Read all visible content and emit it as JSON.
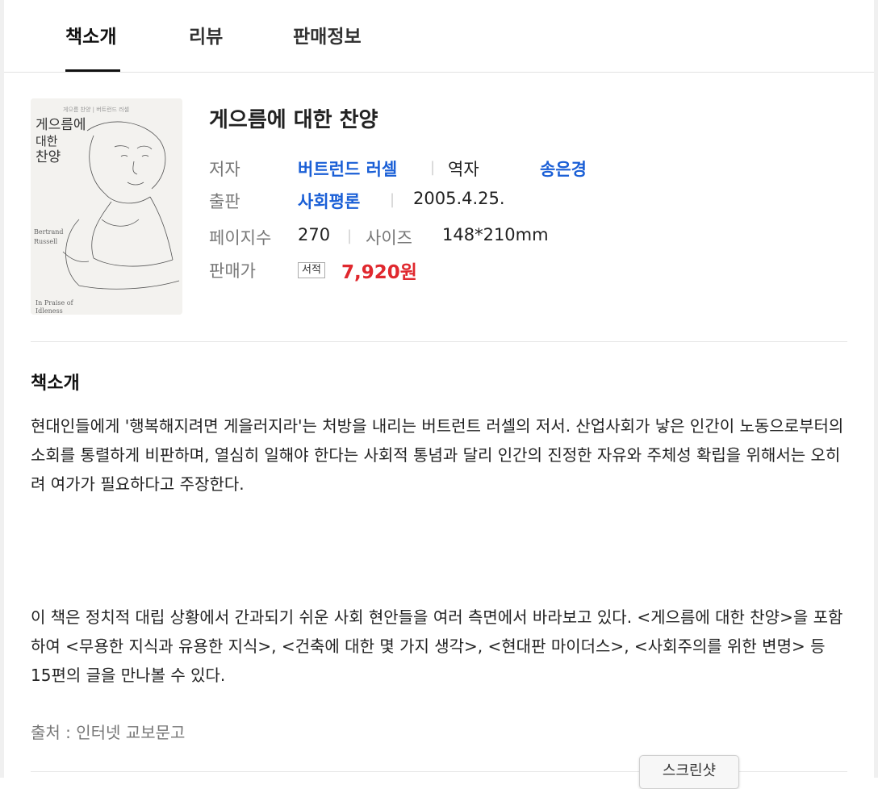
{
  "tabs": [
    {
      "label": "책소개",
      "active": true
    },
    {
      "label": "리뷰",
      "active": false
    },
    {
      "label": "판매정보",
      "active": false
    }
  ],
  "book": {
    "cover_text": {
      "top_small": "게으름 찬양 | 버트런드 러셀",
      "title_line1": "게으름에",
      "title_line2": "대한",
      "title_line3": "찬양",
      "author_en_1": "Bertrand",
      "author_en_2": "Russell",
      "subtitle_en_1": "In Praise of",
      "subtitle_en_2": "Idleness"
    },
    "title": "게으름에 대한 찬양",
    "author_label": "저자",
    "author": "버트런드 러셀",
    "translator_label": "역자",
    "translator": "송은경",
    "publisher_label": "출판",
    "publisher": "사회평론",
    "pub_date": "2005.4.25.",
    "pages_label": "페이지수",
    "pages": "270",
    "size_label": "사이즈",
    "size": "148*210mm",
    "price_label": "판매가",
    "price_badge": "서적",
    "price": "7,920원",
    "separator": "|"
  },
  "intro": {
    "title": "책소개",
    "paragraph1": "현대인들에게 '행복해지려면 게을러지라'는 처방을 내리는 버트런트 러셀의 저서. 산업사회가 낳은 인간이 노동으로부터의 소회를 통렬하게 비판하며, 열심히 일해야 한다는 사회적 통념과 달리 인간의 진정한 자유와 주체성 확립을 위해서는 오히려 여가가 필요하다고 주장한다.",
    "paragraph2": "이 책은 정치적 대립 상황에서 간과되기 쉬운 사회 현안들을 여러 측면에서 바라보고 있다. <게으름에 대한 찬양>을 포함하여 <무용한 지식과 유용한 지식>, <건축에 대한 몇 가지 생각>, <현대판 마이더스>, <사회주의를 위한 변명> 등 15편의 글을 만나볼 수 있다.",
    "source": "출처 : 인터넷 교보문고"
  },
  "screenshot_button": "스크린샷",
  "colors": {
    "link": "#1a5fd6",
    "price": "#e0282e",
    "active_tab_underline": "#111111"
  }
}
